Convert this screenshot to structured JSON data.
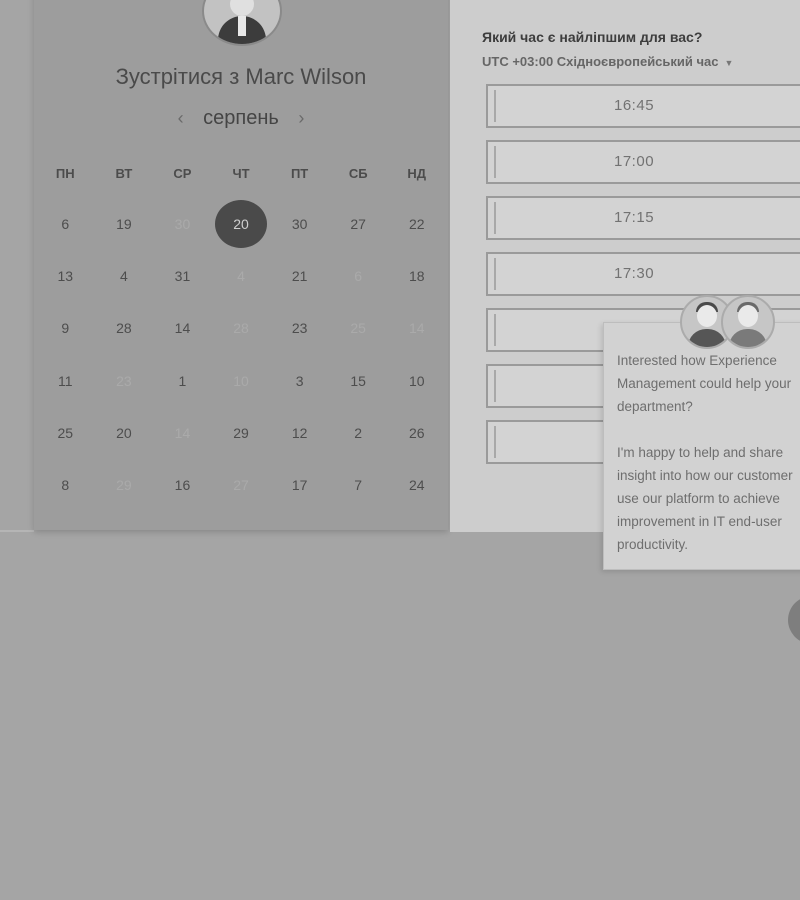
{
  "header": {
    "title": "Зустрітися з Marc Wilson",
    "avatar_icon": "person-avatar-icon"
  },
  "calendar": {
    "month": "серпень",
    "prev_icon": "chevron-left-icon",
    "next_icon": "chevron-right-icon",
    "weekdays": [
      "ПН",
      "ВТ",
      "СР",
      "ЧТ",
      "ПТ",
      "СБ",
      "НД"
    ],
    "rows": [
      [
        {
          "d": "6"
        },
        {
          "d": "19"
        },
        {
          "d": "30",
          "muted": true
        },
        {
          "d": "20",
          "selected": true
        },
        {
          "d": "30"
        },
        {
          "d": "27"
        },
        {
          "d": "22"
        }
      ],
      [
        {
          "d": "13"
        },
        {
          "d": "4"
        },
        {
          "d": "31"
        },
        {
          "d": "4",
          "muted": true
        },
        {
          "d": "21"
        },
        {
          "d": "6",
          "muted": true
        },
        {
          "d": "18"
        }
      ],
      [
        {
          "d": "9"
        },
        {
          "d": "28"
        },
        {
          "d": "14"
        },
        {
          "d": "28",
          "muted": true
        },
        {
          "d": "23"
        },
        {
          "d": "25",
          "muted": true
        },
        {
          "d": "14",
          "muted": true
        }
      ],
      [
        {
          "d": "11"
        },
        {
          "d": "23",
          "muted": true
        },
        {
          "d": "1"
        },
        {
          "d": "10",
          "muted": true
        },
        {
          "d": "3"
        },
        {
          "d": "15"
        },
        {
          "d": "10"
        }
      ],
      [
        {
          "d": "25"
        },
        {
          "d": "20"
        },
        {
          "d": "14",
          "muted": true
        },
        {
          "d": "29"
        },
        {
          "d": "12"
        },
        {
          "d": "2"
        },
        {
          "d": "26"
        }
      ],
      [
        {
          "d": "8"
        },
        {
          "d": "29",
          "muted": true
        },
        {
          "d": "16"
        },
        {
          "d": "27",
          "muted": true
        },
        {
          "d": "17"
        },
        {
          "d": "7"
        },
        {
          "d": "24"
        }
      ]
    ]
  },
  "times": {
    "question": "Який час є найліпшим для вас?",
    "timezone": "UTC +03:00 Східноєвропейський час",
    "slots": [
      "16:45",
      "17:00",
      "17:15",
      "17:30",
      "",
      "",
      ""
    ]
  },
  "chat": {
    "message_1": "Interested how Experience Management could help your department?",
    "message_2": "I'm happy to help and share insight into how our customer use our platform to achieve improvement in IT end-user productivity.",
    "avatar_icons": [
      "person-avatar-icon",
      "person-avatar-icon"
    ]
  },
  "colors": {
    "selected_day": "#4a4a4a",
    "background": "#a5a5a5"
  }
}
